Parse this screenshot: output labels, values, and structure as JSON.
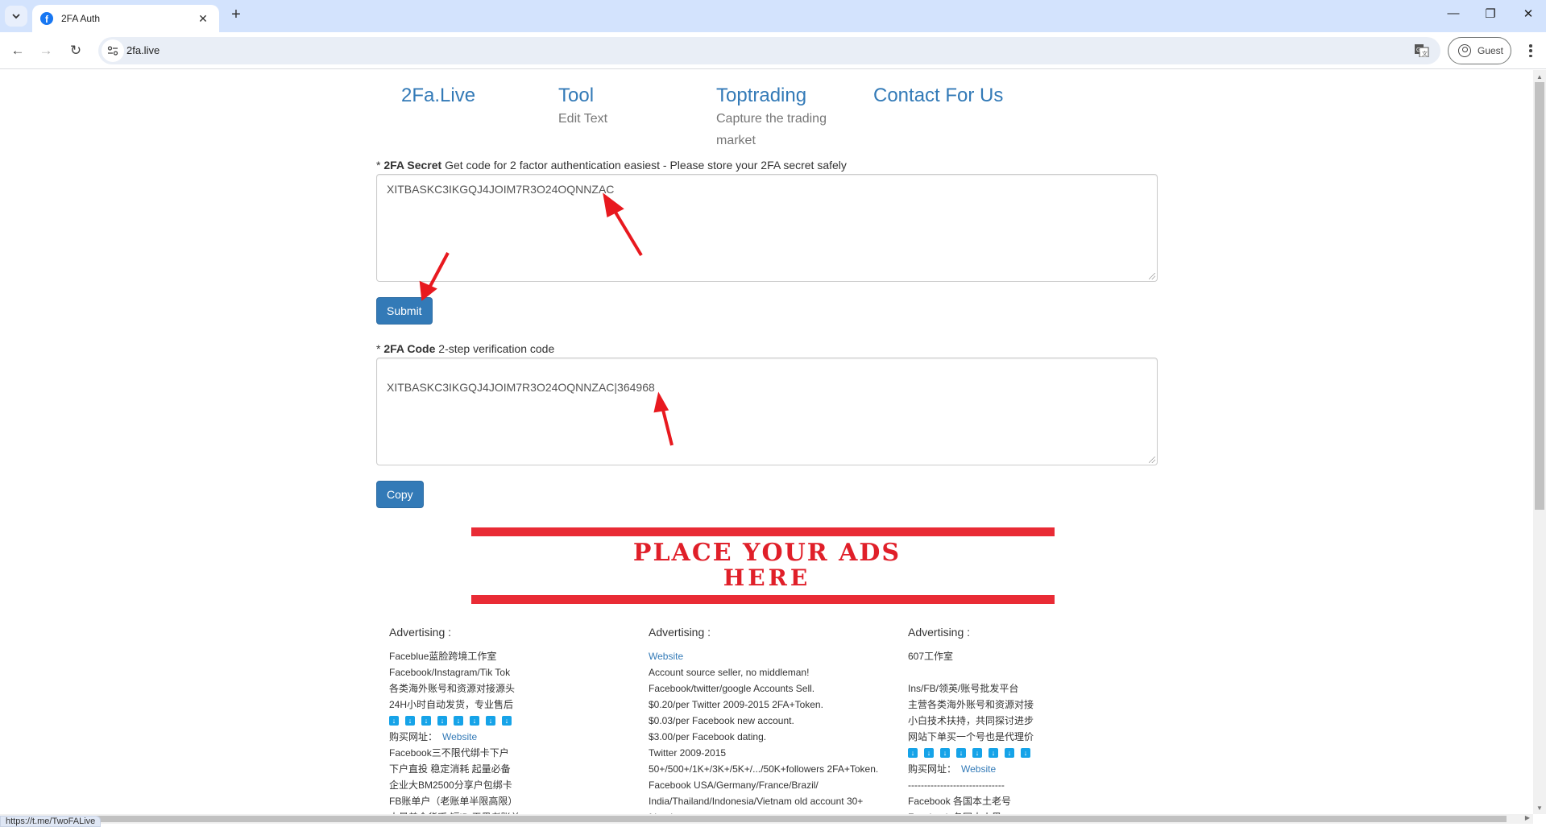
{
  "browser": {
    "tab_title": "2FA Auth",
    "url": "2fa.live",
    "profile_label": "Guest",
    "status_url": "https://t.me/TwoFALive"
  },
  "nav": [
    {
      "title": "2Fa.Live",
      "subtitle": ""
    },
    {
      "title": "Tool",
      "subtitle": "Edit Text"
    },
    {
      "title": "Toptrading",
      "subtitle": "Capture the trading market"
    },
    {
      "title": "Contact For Us",
      "subtitle": ""
    }
  ],
  "secret_section": {
    "required_mark": "*",
    "label_bold": "2FA Secret",
    "label_rest": "Get code for 2 factor authentication easiest - Please store your 2FA secret safely",
    "value": "XITBASKC3IKGQJ4JOIM7R3O24OQNNZAC",
    "submit_label": "Submit"
  },
  "code_section": {
    "required_mark": "*",
    "label_bold": "2FA Code",
    "label_rest": "2-step verification code",
    "value": "XITBASKC3IKGQJ4JOIM7R3O24OQNNZAC|364968",
    "copy_label": "Copy"
  },
  "ad_banner": {
    "line1": "PLACE YOUR ADS",
    "line2": "HERE",
    "color": "#e01f29"
  },
  "ads": [
    {
      "heading": "Advertising :",
      "lines": [
        {
          "text": "Faceblue蓝脸跨境工作室"
        },
        {
          "text": "Facebook/Instagram/Tik Tok"
        },
        {
          "text": "各类海外账号和资源对接源头"
        },
        {
          "text": "24H小时自动发货，专业售后"
        },
        {
          "icons": 8
        },
        {
          "text": "购买网址：",
          "link": "Website"
        },
        {
          "text": "Facebook三不限代绑卡下户"
        },
        {
          "text": "下户直投 稳定消耗 起量必备"
        },
        {
          "text": "企业大BM2500分享户包绑卡"
        },
        {
          "text": "FB账单户（老账单半限高限）"
        },
        {
          "text": "大量美金货币 短ID 天黑老账单"
        }
      ]
    },
    {
      "heading": "Advertising :",
      "lines": [
        {
          "text": "",
          "link": "Website"
        },
        {
          "text": "Account source seller, no middleman!"
        },
        {
          "text": "Facebook/twitter/google Accounts Sell."
        },
        {
          "text": "$0.20/per Twitter 2009-2015 2FA+Token."
        },
        {
          "text": "$0.03/per Facebook new account."
        },
        {
          "text": "$3.00/per Facebook dating."
        },
        {
          "text": "Twitter 2009-2015"
        },
        {
          "text": "50+/500+/1K+/3K+/5K+/.../50K+followers 2FA+Token."
        },
        {
          "text": "Facebook USA/Germany/France/Brazil/"
        },
        {
          "text": "India/Thailand/Indonesia/Vietnam old account 30+"
        },
        {
          "text": "friends"
        }
      ]
    },
    {
      "heading": "Advertising :",
      "lines": [
        {
          "text": "607工作室"
        },
        {
          "text": ""
        },
        {
          "text": "Ins/FB/领英/账号批发平台"
        },
        {
          "text": "主营各类海外账号和资源对接"
        },
        {
          "text": "小白技术扶持，共同探讨进步"
        },
        {
          "text": "网站下单买一个号也是代理价"
        },
        {
          "icons": 8
        },
        {
          "text": "购买网址：",
          "link": "Website"
        },
        {
          "text": "------------------------------"
        },
        {
          "text": "Facebook 各国本土老号"
        },
        {
          "text": "Facebook 各国大小黑"
        }
      ]
    }
  ],
  "annotation_color": "#e8191f",
  "accent_color": "#337ab7"
}
